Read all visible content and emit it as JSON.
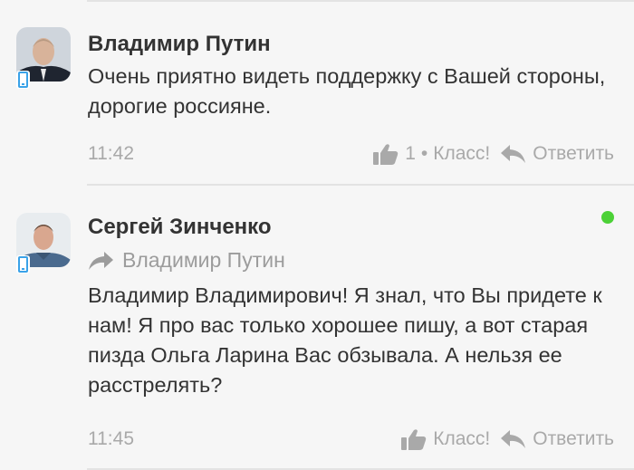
{
  "comments": [
    {
      "author": "Владимир Путин",
      "text": "Очень приятно видеть поддержку с Вашей стороны, дорогие россияне.",
      "time": "11:42",
      "like_count": "1",
      "like_separator": "•",
      "like_label": "Класс!",
      "reply_label": "Ответить",
      "online": false
    },
    {
      "author": "Сергей Зинченко",
      "reply_to": "Владимир Путин",
      "text": "Владимир Владимирович! Я знал, что Вы придете к нам! Я про вас только хорошее пишу, а вот старая пизда Ольга Ларина Вас обзывала. А нельзя ее расстрелять?",
      "time": "11:45",
      "like_label": "Класс!",
      "reply_label": "Ответить",
      "online": true
    }
  ],
  "colors": {
    "background": "#f6f6f6",
    "text": "#333333",
    "muted": "#a9a9a9",
    "online": "#4cd137",
    "device": "#3aa2e8"
  }
}
